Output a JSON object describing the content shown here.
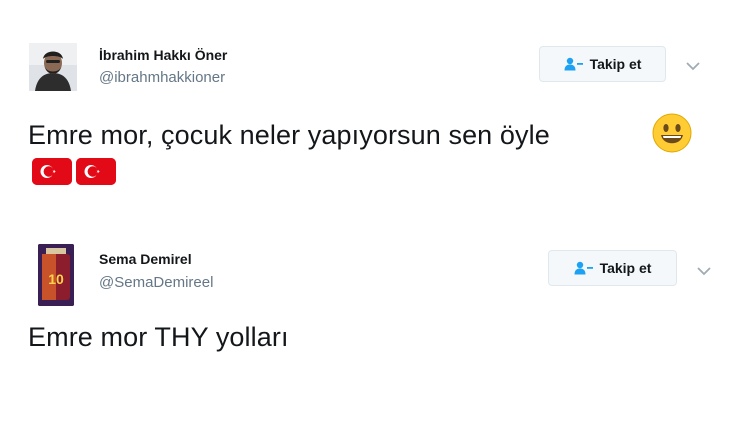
{
  "tweets": [
    {
      "display_name": "İbrahim Hakkı Öner",
      "handle": "@ibrahmhakkioner",
      "follow_label": "Takip et",
      "text": "Emre mor, çocuk neler yapıyorsun sen öyle",
      "emoji": [
        "smiley-emoji",
        "turkey-flag-emoji",
        "turkey-flag-emoji"
      ]
    },
    {
      "display_name": "Sema Demirel",
      "handle": "@SemaDemireel",
      "follow_label": "Takip et",
      "text": "Emre mor THY yolları",
      "avatar_jersey_number": "10"
    }
  ],
  "colors": {
    "follow_icon": "#1da1f2",
    "handle_text": "#657786",
    "flag_red": "#e30a17",
    "smiley_yellow": "#ffcc33"
  }
}
